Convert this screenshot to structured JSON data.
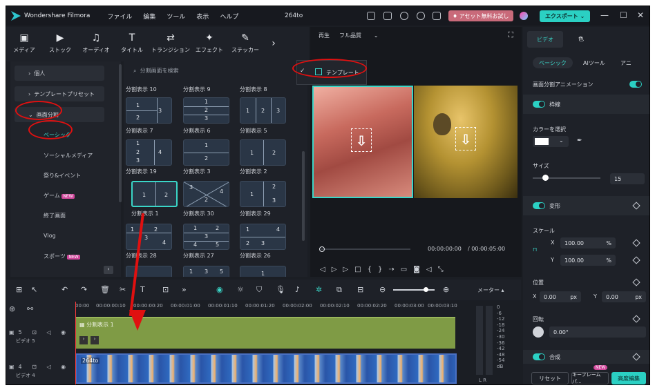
{
  "app": {
    "title": "Wondershare Filmora",
    "doc": "264to",
    "menu": [
      "ファイル",
      "編集",
      "ツール",
      "表示",
      "ヘルプ"
    ],
    "trial": "アセット無料お試し",
    "export": "エクスポート"
  },
  "media_tabs": [
    "メディア",
    "ストック",
    "オーディオ",
    "タイトル",
    "トランジション",
    "エフェクト",
    "ステッカー"
  ],
  "nav": {
    "items": [
      "個人",
      "テンプレートプリセット",
      "画面分割"
    ],
    "sub": [
      "ベーシック",
      "ソーシャルメディア",
      "祭り&イベント",
      "ゲーム",
      "終了画面",
      "Vlog",
      "スポーツ"
    ],
    "new": "NEW"
  },
  "grid": {
    "search": "分割画面を検索",
    "labels": [
      "分割表示 10",
      "分割表示 9",
      "分割表示 8",
      "分割表示 7",
      "分割表示 6",
      "分割表示 5",
      "分割表示 19",
      "分割表示 3",
      "分割表示 2",
      "分割表示 1",
      "分割表示 30",
      "分割表示 29",
      "分割表示 28",
      "分割表示 27",
      "分割表示 26"
    ]
  },
  "preview": {
    "play": "再生",
    "quality": "フル品質",
    "template": "テンプレート",
    "time_current": "00:00:00:00",
    "time_total": "/ 00:00:05:00"
  },
  "right": {
    "tab_video": "ビデオ",
    "tab_color": "色",
    "chips": [
      "ベーシック",
      "AIツール",
      "アニ"
    ],
    "split_anim": "画面分割アニメーション",
    "border": "枠線",
    "color_pick": "カラーを選択",
    "size": "サイズ",
    "size_value": "15",
    "transform": "変形",
    "scale": "スケール",
    "x": "X",
    "y": "Y",
    "scale_x": "100.00",
    "scale_y": "100.00",
    "pct": "%",
    "position": "位置",
    "pos_x": "0.00",
    "pos_y": "0.00",
    "px": "px",
    "rotate": "回転",
    "rotate_value": "0.00°",
    "composite": "合成",
    "reset": "リセット",
    "keyframe": "キーフレームパ...",
    "advanced": "高度編集",
    "new": "NEW"
  },
  "timeline": {
    "meter": "メーター",
    "ticks": [
      "00:00",
      "00:00:00:10",
      "00:00:00:20",
      "00:00:01:00",
      "00:00:01:10",
      "00:00:01:20",
      "00:00:02:00",
      "00:00:02:10",
      "00:00:02:20",
      "00:00:03:00",
      "00:00:03:10"
    ],
    "track5": "ビデオ 5",
    "track4": "ビデオ 4",
    "clip_a": "分割表示 1",
    "clip_b": "264to",
    "meter_scale": [
      "0",
      "-6",
      "-12",
      "-18",
      "-24",
      "-30",
      "-36",
      "-42",
      "-48",
      "-54",
      "dB"
    ],
    "lr": "L  R"
  }
}
